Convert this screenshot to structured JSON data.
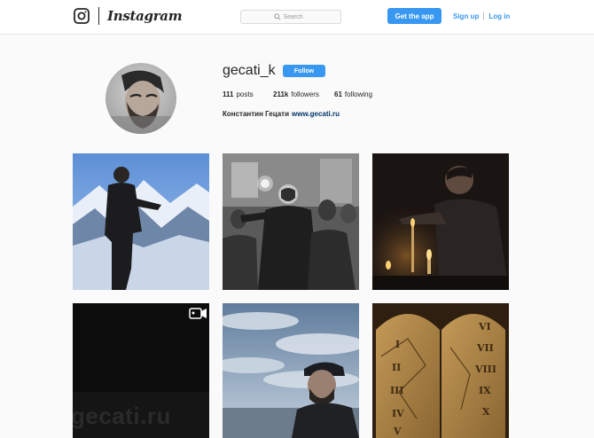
{
  "header": {
    "brand": "Instagram",
    "search_placeholder": "Search",
    "get_app_label": "Get the app",
    "sign_up_label": "Sign up",
    "log_in_label": "Log in"
  },
  "profile": {
    "username": "gecati_k",
    "follow_label": "Follow",
    "posts_count": "111",
    "posts_label": "posts",
    "followers_count": "211k",
    "followers_label": "followers",
    "following_count": "61",
    "following_label": "following",
    "full_name": "Константин Гецати",
    "website": "www.gecati.ru"
  },
  "posts": [
    {
      "subject": "man-in-mountains",
      "is_video": false
    },
    {
      "subject": "man-with-crowd",
      "is_video": false
    },
    {
      "subject": "man-with-candles",
      "is_video": false
    },
    {
      "subject": "dark-video-gecati",
      "is_video": true,
      "watermark": "gecati.ru"
    },
    {
      "subject": "man-by-sea",
      "is_video": false
    },
    {
      "subject": "stone-tablets",
      "is_video": false
    }
  ],
  "colors": {
    "accent": "#3897f0",
    "link": "#003569",
    "background": "#fafafa"
  }
}
